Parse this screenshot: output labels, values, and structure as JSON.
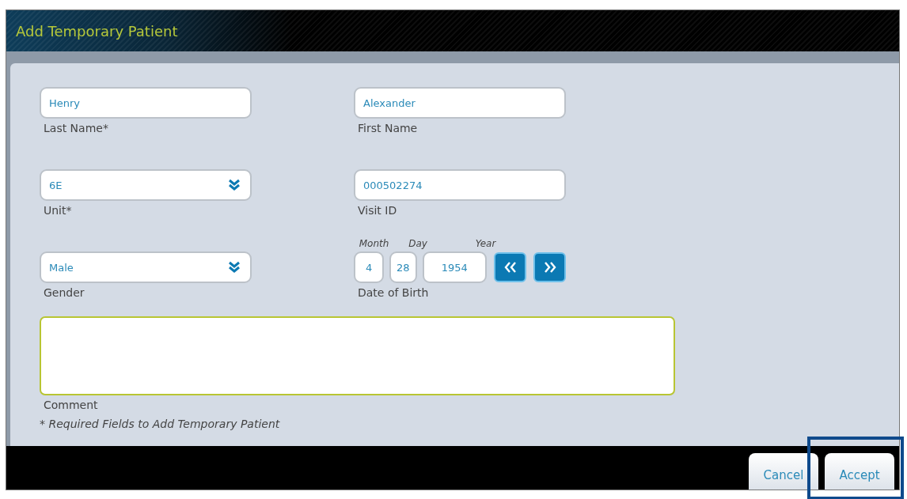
{
  "window": {
    "title": "Add Temporary Patient"
  },
  "fields": [
    {
      "kind": "text",
      "value": "Henry",
      "label": "Last Name*"
    },
    {
      "kind": "dropdown",
      "value": "6E",
      "label": "Unit*"
    },
    {
      "kind": "dropdown",
      "value": "Male",
      "label": "Gender"
    },
    {
      "kind": "text",
      "value": "Alexander",
      "label": "First Name"
    },
    {
      "kind": "text",
      "value": "000502274",
      "label": "Visit ID"
    },
    {
      "kind": "date",
      "label": "Date of Birth",
      "parts": [
        {
          "caption": "Month",
          "value": "4"
        },
        {
          "caption": "Day",
          "value": "28"
        },
        {
          "caption": "Year",
          "value": "1954"
        }
      ]
    }
  ],
  "comment": {
    "label": "Comment"
  },
  "note": "* Required Fields to Add Temporary Patient",
  "buttons": [
    {
      "label": "Cancel"
    },
    {
      "label": "Accept"
    }
  ]
}
